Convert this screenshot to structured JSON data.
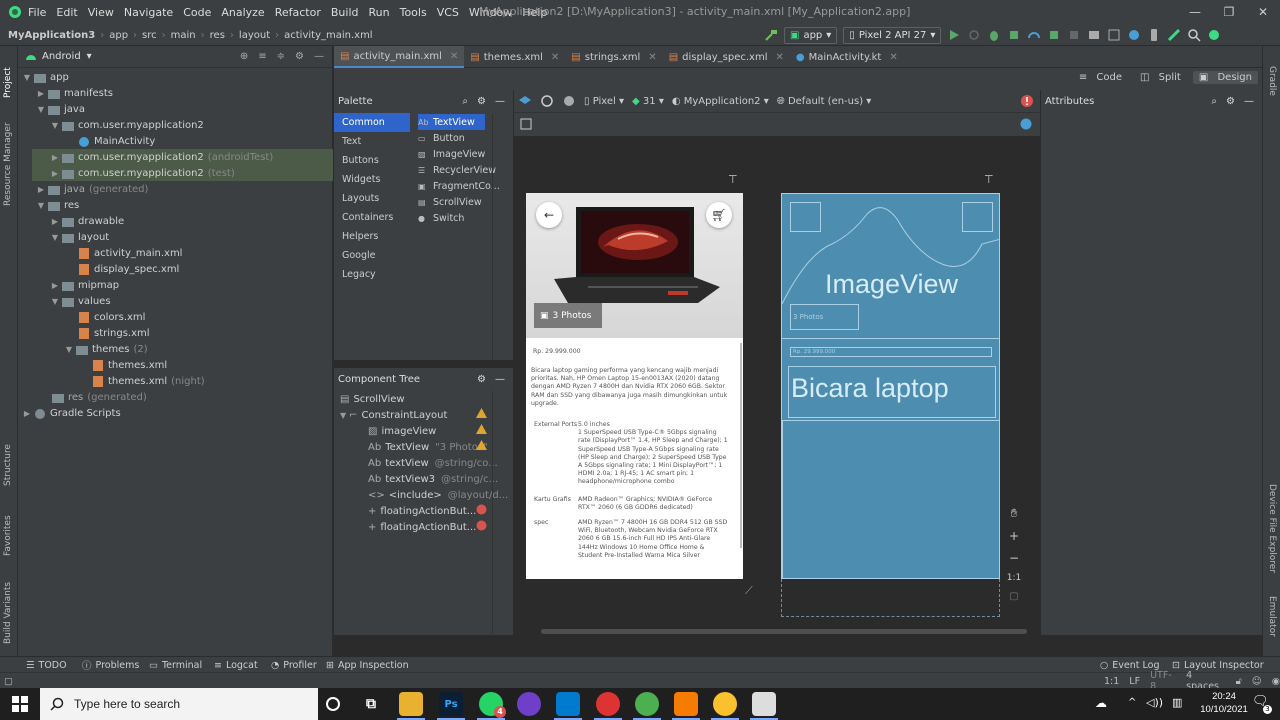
{
  "menubar": {
    "items": [
      "File",
      "Edit",
      "View",
      "Navigate",
      "Code",
      "Analyze",
      "Refactor",
      "Build",
      "Run",
      "Tools",
      "VCS",
      "Window",
      "Help"
    ],
    "window_title": "MyApplication2 [D:\\MyApplication3] - activity_main.xml [My_Application2.app]",
    "controls": [
      "—",
      "❐",
      "✕"
    ]
  },
  "navbar": {
    "crumbs": [
      "MyApplication3",
      "app",
      "src",
      "main",
      "res",
      "layout",
      "activity_main.xml"
    ],
    "run_config": "app",
    "device": "Pixel 2 API 27"
  },
  "left_stripe": {
    "project": "Project",
    "resource_manager": "Resource Manager",
    "structure": "Structure",
    "favorites": "Favorites",
    "build_variants": "Build Variants"
  },
  "right_stripe": {
    "gradle": "Gradle",
    "device_file_explorer": "Device File Explorer",
    "emulator": "Emulator"
  },
  "project": {
    "view_mode": "Android",
    "tree": [
      {
        "label": "app",
        "extra": ""
      },
      {
        "label": "manifests",
        "extra": ""
      },
      {
        "label": "java",
        "extra": ""
      },
      {
        "label": "com.user.myapplication2",
        "extra": ""
      },
      {
        "label": "MainActivity",
        "extra": ""
      },
      {
        "label": "com.user.myapplication2",
        "extra": "(androidTest)"
      },
      {
        "label": "com.user.myapplication2",
        "extra": "(test)"
      },
      {
        "label": "java",
        "extra": "(generated)"
      },
      {
        "label": "res",
        "extra": ""
      },
      {
        "label": "drawable",
        "extra": ""
      },
      {
        "label": "layout",
        "extra": ""
      },
      {
        "label": "activity_main.xml",
        "extra": ""
      },
      {
        "label": "display_spec.xml",
        "extra": ""
      },
      {
        "label": "mipmap",
        "extra": ""
      },
      {
        "label": "values",
        "extra": ""
      },
      {
        "label": "colors.xml",
        "extra": ""
      },
      {
        "label": "strings.xml",
        "extra": ""
      },
      {
        "label": "themes",
        "extra": "(2)"
      },
      {
        "label": "themes.xml",
        "extra": ""
      },
      {
        "label": "themes.xml",
        "extra": "(night)"
      },
      {
        "label": "res",
        "extra": "(generated)"
      },
      {
        "label": "Gradle Scripts",
        "extra": ""
      }
    ]
  },
  "tabs": [
    "activity_main.xml",
    "themes.xml",
    "strings.xml",
    "display_spec.xml",
    "MainActivity.kt"
  ],
  "modes": [
    "Code",
    "Split",
    "Design"
  ],
  "palette": {
    "title": "Palette",
    "categories": [
      "Common",
      "Text",
      "Buttons",
      "Widgets",
      "Layouts",
      "Containers",
      "Helpers",
      "Google",
      "Legacy"
    ],
    "items": [
      "TextView",
      "Button",
      "ImageView",
      "RecyclerView",
      "FragmentCo...",
      "ScrollView",
      "Switch"
    ],
    "item_glyphs": [
      "Ab",
      "▭",
      "▨",
      "☰",
      "▣",
      "▤",
      "●"
    ]
  },
  "surface_toolbar": {
    "device": "Pixel",
    "api": "31",
    "theme": "MyApplication2",
    "locale": "Default (en-us)"
  },
  "component_tree": {
    "title": "Component Tree",
    "items": [
      {
        "label": "ScrollView",
        "ref": ""
      },
      {
        "label": "ConstraintLayout",
        "ref": ""
      },
      {
        "label": "imageView",
        "ref": ""
      },
      {
        "label": "TextView",
        "ref": "\"3 Photos\""
      },
      {
        "label": "textView",
        "ref": "@string/co..."
      },
      {
        "label": "textView3",
        "ref": "@string/c..."
      },
      {
        "label": "<include>",
        "ref": "@layout/d..."
      },
      {
        "label": "floatingActionBut...",
        "ref": ""
      },
      {
        "label": "floatingActionBut...",
        "ref": ""
      }
    ],
    "glyphs": [
      "",
      "",
      "▨",
      "Ab",
      "Ab",
      "Ab",
      "<>",
      "+",
      "+"
    ]
  },
  "phone": {
    "photos_badge": "3 Photos",
    "price": "Rp. 29.999.000",
    "description": "Bicara laptop gaming performa yang kencang wajib menjadi prioritas. Nah, HP Omen Laptop 15-en0013AX (2020) datang dengan AMD Ryzen 7 4800H dan Nvidia RTX 2060 6GB. Sektor RAM dan SSD yang dibawanya juga masih dimungkinkan untuk upgrade.",
    "specs": [
      {
        "key": "External Ports",
        "value": "5.0 inches\n1 SuperSpeed USB Type-C® 5Gbps signaling rate (DisplayPort™ 1.4, HP Sleep and Charge); 1 SuperSpeed USB Type-A 5Gbps signaling rate (HP Sleep and Charge); 2 SuperSpeed USB Type A 5Gbps signaling rate; 1 Mini DisplayPort™; 1 HDMI 2.0a; 1 RJ-45; 1 AC smart pin; 1 headphone/microphone combo"
      },
      {
        "key": "Kartu Grafis",
        "value": "AMD Radeon™ Graphics; NVIDIA® GeForce RTX™ 2060 (6 GB GDDR6 dedicated)"
      },
      {
        "key": "spec",
        "value": "AMD Ryzen™ 7 4800H 16 GB DDR4 512 GB SSD WiFi, Bluetooth, Webcam Nvidia GeForce RTX 2060 6 GB 15.6-inch Full HD IPS Anti-Glare 144Hz Windows 10 Home Office Home & Student Pre-Installed Warna Mica Silver"
      }
    ]
  },
  "blueprint": {
    "image_label": "ImageView",
    "photos_label": "3 Photos",
    "price_label": "Rp. 29.999.000",
    "text_label": "Bicara laptop"
  },
  "zoom_ratio": "1:1",
  "attributes": {
    "title": "Attributes"
  },
  "bottom_tools": [
    "TODO",
    "Problems",
    "Terminal",
    "Logcat",
    "Profiler",
    "App Inspection"
  ],
  "bottom_right_tools": [
    "Event Log",
    "Layout Inspector"
  ],
  "status": {
    "position": "1:1",
    "line_sep": "LF",
    "encoding": "UTF-8",
    "indent": "4 spaces"
  },
  "taskbar": {
    "search_placeholder": "Type here to search",
    "time": "20:24",
    "date": "10/10/2021",
    "whatsapp_badge": "4",
    "notif_count": "3",
    "photoshop": "Ps"
  }
}
